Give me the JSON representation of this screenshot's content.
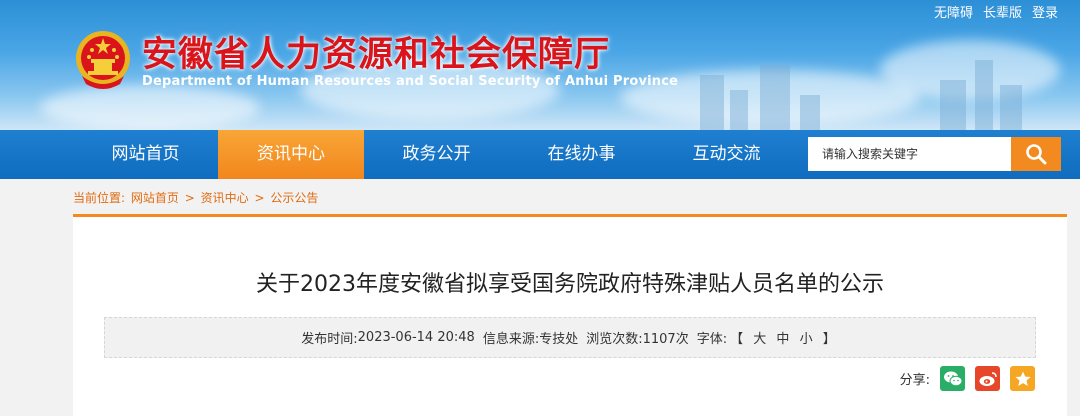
{
  "header": {
    "top_links": [
      "无障碍",
      "长辈版",
      "登录"
    ],
    "title": "安徽省人力资源和社会保障厅",
    "subtitle": "Department of Human Resources and Social Security of Anhui Province",
    "emblem_icon": "national-emblem-icon"
  },
  "nav": {
    "items": [
      {
        "label": "网站首页"
      },
      {
        "label": "资讯中心",
        "active": true
      },
      {
        "label": "政务公开"
      },
      {
        "label": "在线办事"
      },
      {
        "label": "互动交流"
      }
    ],
    "search_placeholder": "请输入搜索关键字",
    "search_icon": "search-icon",
    "active_color": "#f28a1f",
    "bar_color": "#1470c4"
  },
  "breadcrumb": {
    "label": "当前位置:",
    "items": [
      "网站首页",
      "资讯中心",
      "公示公告"
    ],
    "separator": ">"
  },
  "article": {
    "title": "关于2023年度安徽省拟享受国务院政府特殊津贴人员名单的公示",
    "meta": {
      "publish_label": "发布时间:",
      "publish_time": "2023-06-14 20:48",
      "source_label": "信息来源:",
      "source": "专技处",
      "views_label": "浏览次数:",
      "views": "1107次",
      "font_label": "字体:",
      "font_open": "【",
      "font_large": "大",
      "font_medium": "中",
      "font_small": "小",
      "font_close": "】"
    },
    "share": {
      "label": "分享:",
      "icons": [
        "wechat-icon",
        "weibo-icon",
        "favorite-icon"
      ]
    }
  }
}
